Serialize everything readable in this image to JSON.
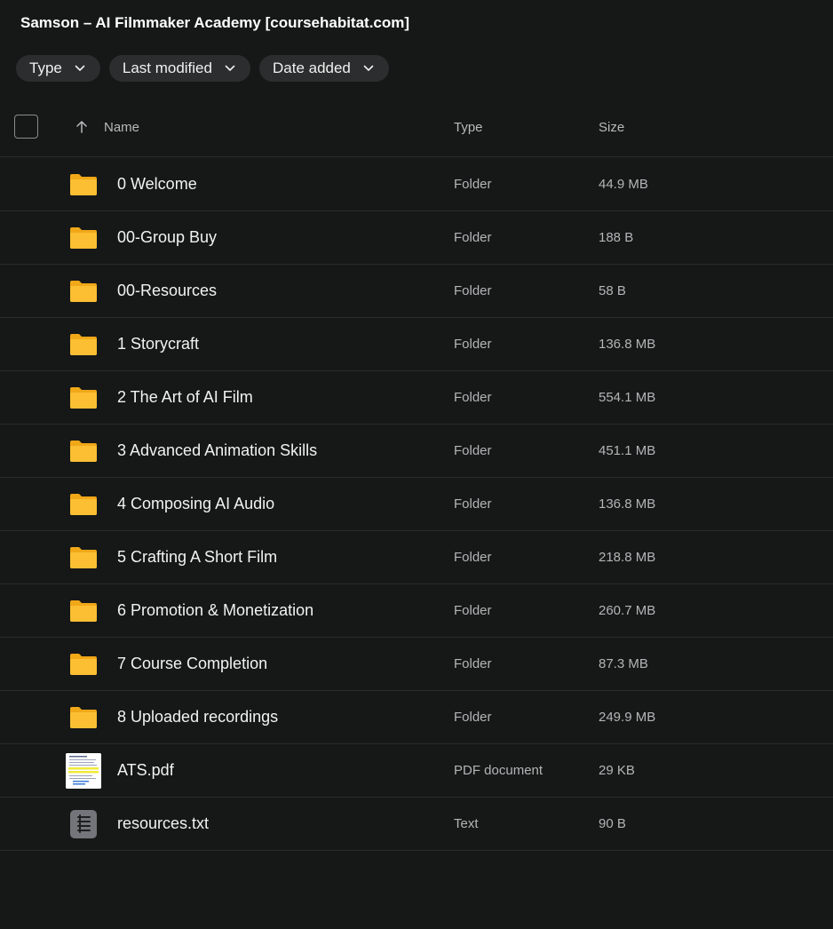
{
  "title": "Samson – AI Filmmaker Academy [coursehabitat.com]",
  "filters": [
    {
      "label": "Type"
    },
    {
      "label": "Last modified"
    },
    {
      "label": "Date added"
    }
  ],
  "header": {
    "name": "Name",
    "type": "Type",
    "size": "Size"
  },
  "colors": {
    "background": "#161717",
    "chip": "#2c2d2e",
    "folder": "#f7b928",
    "divider": "#2a2b2c"
  },
  "rows": [
    {
      "name": "0 Welcome",
      "type": "Folder",
      "size": "44.9 MB",
      "icon": "folder-icon"
    },
    {
      "name": "00-Group Buy",
      "type": "Folder",
      "size": "188 B",
      "icon": "folder-icon"
    },
    {
      "name": "00-Resources",
      "type": "Folder",
      "size": "58 B",
      "icon": "folder-icon"
    },
    {
      "name": "1 Storycraft",
      "type": "Folder",
      "size": "136.8 MB",
      "icon": "folder-icon"
    },
    {
      "name": "2 The Art of AI Film",
      "type": "Folder",
      "size": "554.1 MB",
      "icon": "folder-icon"
    },
    {
      "name": "3 Advanced Animation Skills",
      "type": "Folder",
      "size": "451.1 MB",
      "icon": "folder-icon"
    },
    {
      "name": "4 Composing AI Audio",
      "type": "Folder",
      "size": "136.8 MB",
      "icon": "folder-icon"
    },
    {
      "name": "5 Crafting A Short Film",
      "type": "Folder",
      "size": "218.8 MB",
      "icon": "folder-icon"
    },
    {
      "name": "6 Promotion & Monetization",
      "type": "Folder",
      "size": "260.7 MB",
      "icon": "folder-icon"
    },
    {
      "name": "7 Course Completion",
      "type": "Folder",
      "size": "87.3 MB",
      "icon": "folder-icon"
    },
    {
      "name": "8 Uploaded recordings",
      "type": "Folder",
      "size": "249.9 MB",
      "icon": "folder-icon"
    },
    {
      "name": "ATS.pdf",
      "type": "PDF document",
      "size": "29 KB",
      "icon": "pdf-thumbnail-icon"
    },
    {
      "name": "resources.txt",
      "type": "Text",
      "size": "90 B",
      "icon": "text-file-icon"
    }
  ]
}
